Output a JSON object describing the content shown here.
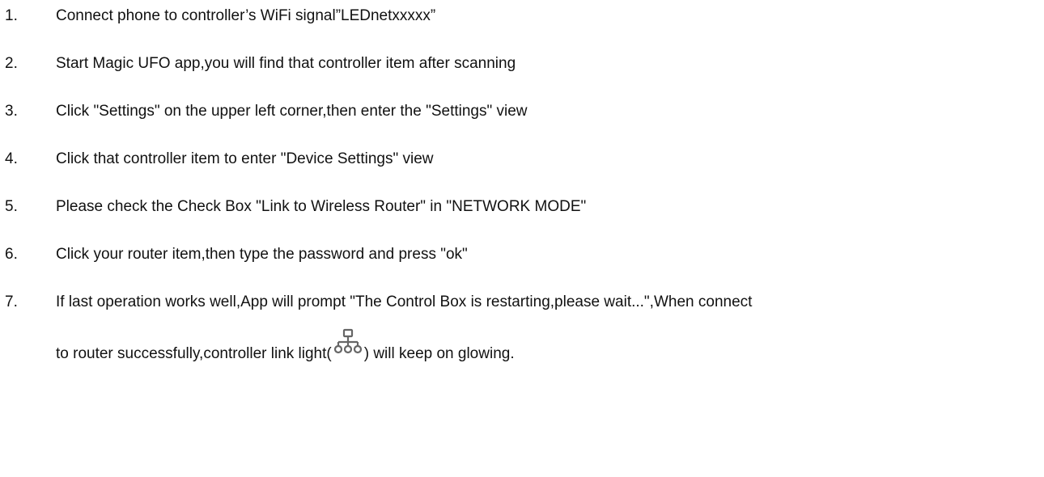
{
  "steps": [
    {
      "number": "1.",
      "text": "Connect phone to controller’s WiFi signal”LEDnetxxxxx”"
    },
    {
      "number": "2.",
      "text": "Start Magic UFO app,you will find that controller item after scanning"
    },
    {
      "number": "3.",
      "text": "Click \"Settings\" on the upper left corner,then enter the \"Settings\" view"
    },
    {
      "number": "4.",
      "text": "Click that controller item to enter \"Device Settings\" view"
    },
    {
      "number": "5.",
      "text": "Please check the Check Box \"Link to Wireless Router\" in \"NETWORK MODE\""
    },
    {
      "number": "6.",
      "text": "Click your router item,then type the password and press \"ok\""
    },
    {
      "number": "7.",
      "text": "If last operation works well,App will prompt \"The Control Box is restarting,please wait...\",When connect",
      "continuation_before_icon": "to router successfully,controller link light(",
      "continuation_after_icon": ") will keep on glowing.",
      "icon": "network-link-icon"
    }
  ],
  "colors": {
    "text": "#111111",
    "icon": "#666666",
    "background": "#ffffff"
  }
}
